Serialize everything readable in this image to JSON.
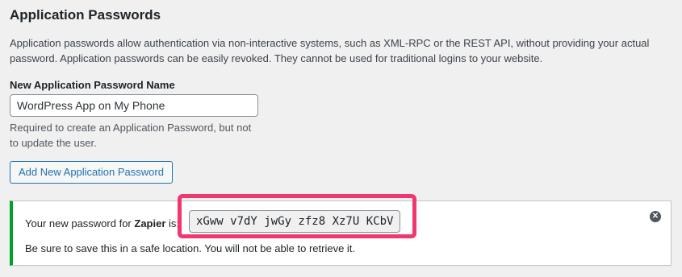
{
  "section": {
    "title": "Application Passwords",
    "description": "Application passwords allow authentication via non-interactive systems, such as XML-RPC or the REST API, without providing your actual password. Application passwords can be easily revoked. They cannot be used for traditional logins to your website."
  },
  "form": {
    "name_label": "New Application Password Name",
    "name_value": "WordPress App on My Phone",
    "help_text": "Required to create an Application Password, but not to update the user.",
    "add_button_label": "Add New Application Password"
  },
  "notice": {
    "prefix_text": "Your new password for ",
    "app_name": "Zapier",
    "suffix_text": " is:",
    "password": "xGww v7dY jwGy zfz8 Xz7U KCbV",
    "warning_text": "Be sure to save this in a safe location. You will not be able to retrieve it.",
    "dismiss_icon": "close-circle-icon"
  },
  "colors": {
    "background": "#f0f0f1",
    "accent_blue": "#2271b1",
    "success_green": "#00a32a",
    "highlight_pink": "#f0386f"
  }
}
